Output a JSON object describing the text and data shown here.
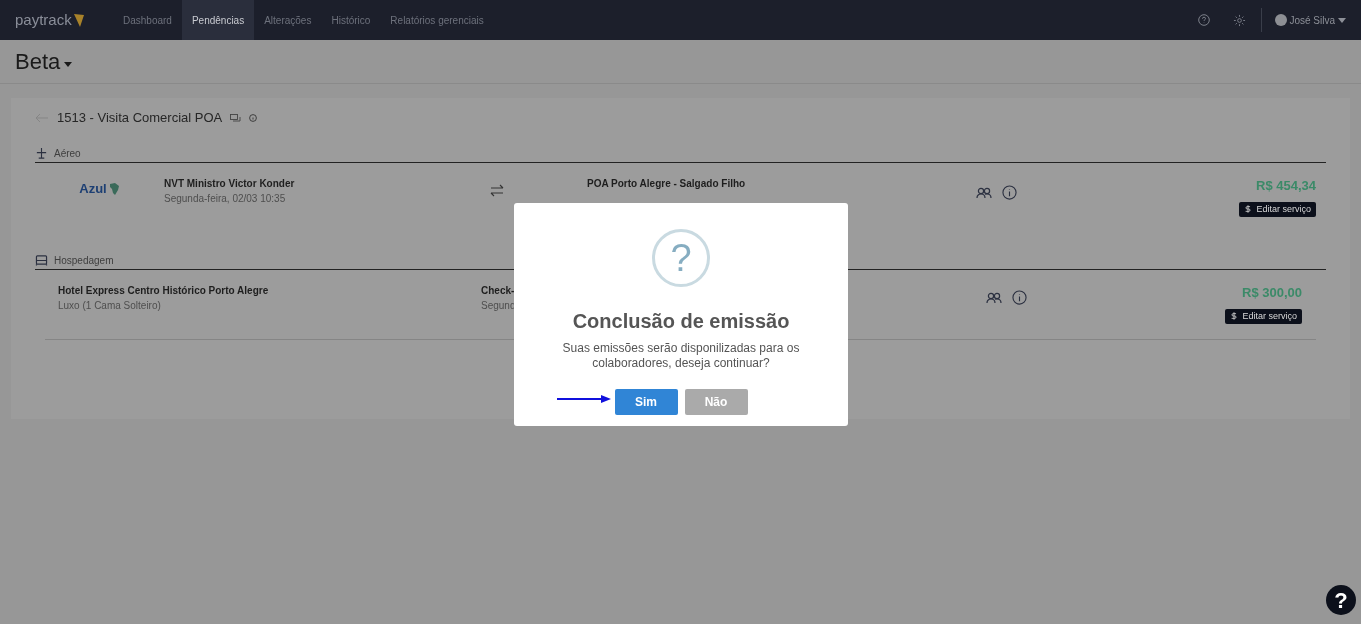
{
  "nav": {
    "logo": "paytrack",
    "tabs": [
      {
        "label": "Dashboard",
        "selected": false
      },
      {
        "label": "Pendências",
        "selected": true
      },
      {
        "label": "Alterações",
        "selected": false
      },
      {
        "label": "Histórico",
        "selected": false
      },
      {
        "label": "Relatórios gerenciais",
        "selected": false
      }
    ],
    "user": "José Silva"
  },
  "page_title": "Beta",
  "trip_title": "1513 - Visita Comercial POA",
  "sections": [
    {
      "kind": "flight",
      "title": "Aéreo",
      "items": [
        {
          "logo": "Azul",
          "col_1_title": "NVT Ministro Victor Konder",
          "col_1_sub": "Segunda-feira, 02/03 10:35",
          "col_2_title": "POA Porto Alegre - Salgado Filho",
          "price": "R$ 454,34",
          "edit_label": "Editar serviço"
        }
      ]
    },
    {
      "kind": "hotel",
      "title": "Hospedagem",
      "items": [
        {
          "col_1_title": "Hotel Express Centro Histórico Porto Alegre",
          "col_1_sub": "Luxo (1 Cama Solteiro)",
          "col_2_title": "Check-",
          "col_2_sub": "Segund",
          "price": "R$ 300,00",
          "edit_label": "Editar serviço"
        }
      ]
    }
  ],
  "modal": {
    "icon": "?",
    "title": "Conclusão de emissão",
    "message": "Suas emissões serão disponilizadas para os colaboradores, deseja continuar?",
    "buttons": [
      {
        "label": "Sim",
        "kind": "primary"
      },
      {
        "label": "Não",
        "kind": "secondary"
      }
    ]
  },
  "help_button": "?"
}
